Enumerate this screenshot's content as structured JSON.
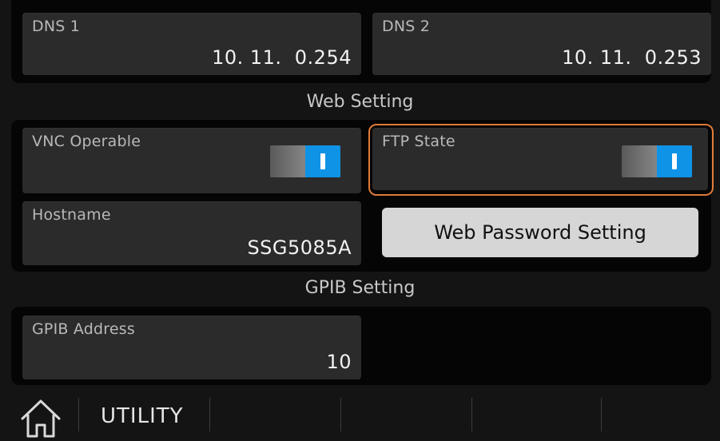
{
  "network": {
    "dns1": {
      "label": "DNS 1",
      "value": "10. 11.  0.254"
    },
    "dns2": {
      "label": "DNS 2",
      "value": "10. 11.  0.253"
    }
  },
  "web_setting": {
    "title": "Web Setting",
    "vnc": {
      "label": "VNC Operable",
      "state": "on"
    },
    "ftp": {
      "label": "FTP State",
      "state": "on"
    },
    "hostname": {
      "label": "Hostname",
      "value": "SSG5085A"
    },
    "password_button": "Web Password Setting"
  },
  "gpib_setting": {
    "title": "GPIB Setting",
    "address": {
      "label": "GPIB Address",
      "value": "10"
    }
  },
  "bottom_bar": {
    "home_icon": "home-icon",
    "tab_label": "UTILITY"
  },
  "colors": {
    "accent_blue": "#0f93e6",
    "focus_orange": "#e07b39"
  }
}
